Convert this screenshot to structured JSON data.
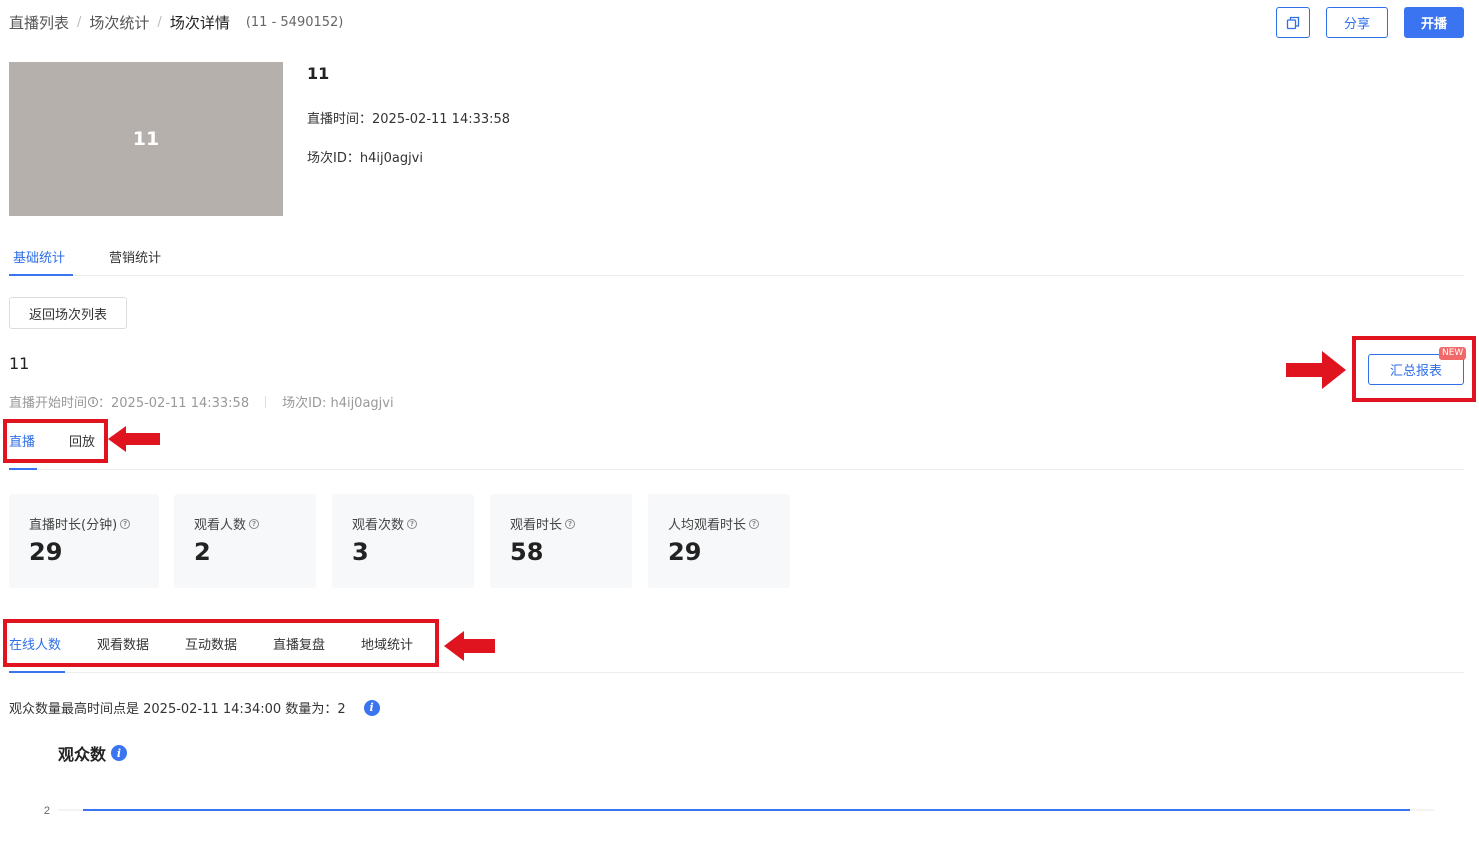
{
  "breadcrumb": {
    "items": [
      "直播列表",
      "场次统计",
      "场次详情"
    ],
    "id_text": "(11 - 5490152)"
  },
  "header": {
    "share_label": "分享",
    "start_label": "开播"
  },
  "event": {
    "cover_text": "11",
    "title": "11",
    "live_time": "直播时间：2025-02-11 14:33:58",
    "session_id": "场次ID：h4ij0agjvi"
  },
  "main_tabs": [
    {
      "label": "基础统计",
      "active": true
    },
    {
      "label": "营销统计",
      "active": false
    }
  ],
  "back_label": "返回场次列表",
  "session": {
    "name": "11",
    "start_label": "直播开始时间",
    "start_value": "：2025-02-11 14:33:58",
    "session_id": "场次ID: h4ij0agjvi"
  },
  "report": {
    "label": "汇总报表",
    "badge": "NEW"
  },
  "live_tabs": [
    {
      "label": "直播",
      "active": true
    },
    {
      "label": "回放",
      "active": false
    }
  ],
  "stats": [
    {
      "label": "直播时长(分钟)",
      "value": "29"
    },
    {
      "label": "观看人数",
      "value": "2"
    },
    {
      "label": "观看次数",
      "value": "3"
    },
    {
      "label": "观看时长",
      "value": "58"
    },
    {
      "label": "人均观看时长",
      "value": "29"
    }
  ],
  "data_tabs": [
    {
      "label": "在线人数",
      "active": true
    },
    {
      "label": "观看数据",
      "active": false
    },
    {
      "label": "互动数据",
      "active": false
    },
    {
      "label": "直播复盘",
      "active": false
    },
    {
      "label": "地域统计",
      "active": false
    }
  ],
  "peak_text": "观众数量最高时间点是 2025-02-11 14:34:00 数量为：2",
  "chart_data": {
    "type": "line",
    "title": "观众数",
    "y_ticks": [
      "2"
    ],
    "series": [
      {
        "values": [
          2,
          2
        ]
      }
    ],
    "ylim": [
      0,
      2
    ]
  },
  "colors": {
    "accent": "#3b74f0",
    "highlight": "#e0141e",
    "cover": "#b5b0ab",
    "badge": "#f06a6a"
  }
}
